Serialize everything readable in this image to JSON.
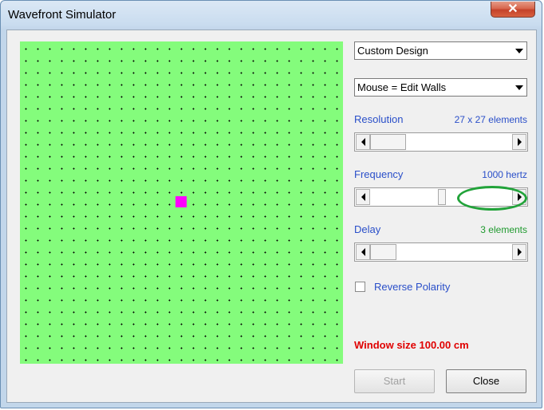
{
  "window": {
    "title": "Wavefront Simulator"
  },
  "titlebar": {
    "close_glyph": "✕",
    "close_icon": "close-icon"
  },
  "controls": {
    "design_select": {
      "value": "Custom Design"
    },
    "mouse_select": {
      "value": "Mouse = Edit Walls"
    },
    "resolution": {
      "label": "Resolution",
      "value": "27 x 27 elements"
    },
    "frequency": {
      "label": "Frequency",
      "value": "1000 hertz"
    },
    "delay": {
      "label": "Delay",
      "value": "3 elements"
    },
    "reverse_polarity": {
      "label": "Reverse Polarity",
      "checked": false
    },
    "window_size": "Window size 100.00 cm"
  },
  "buttons": {
    "start": "Start",
    "close": "Close"
  },
  "colors": {
    "grid_background": "#84fc7c",
    "source_marker": "#ff00ff",
    "label_blue": "#2a4fc9",
    "annotation_green": "#22a33a",
    "warning_red": "#e00000"
  }
}
